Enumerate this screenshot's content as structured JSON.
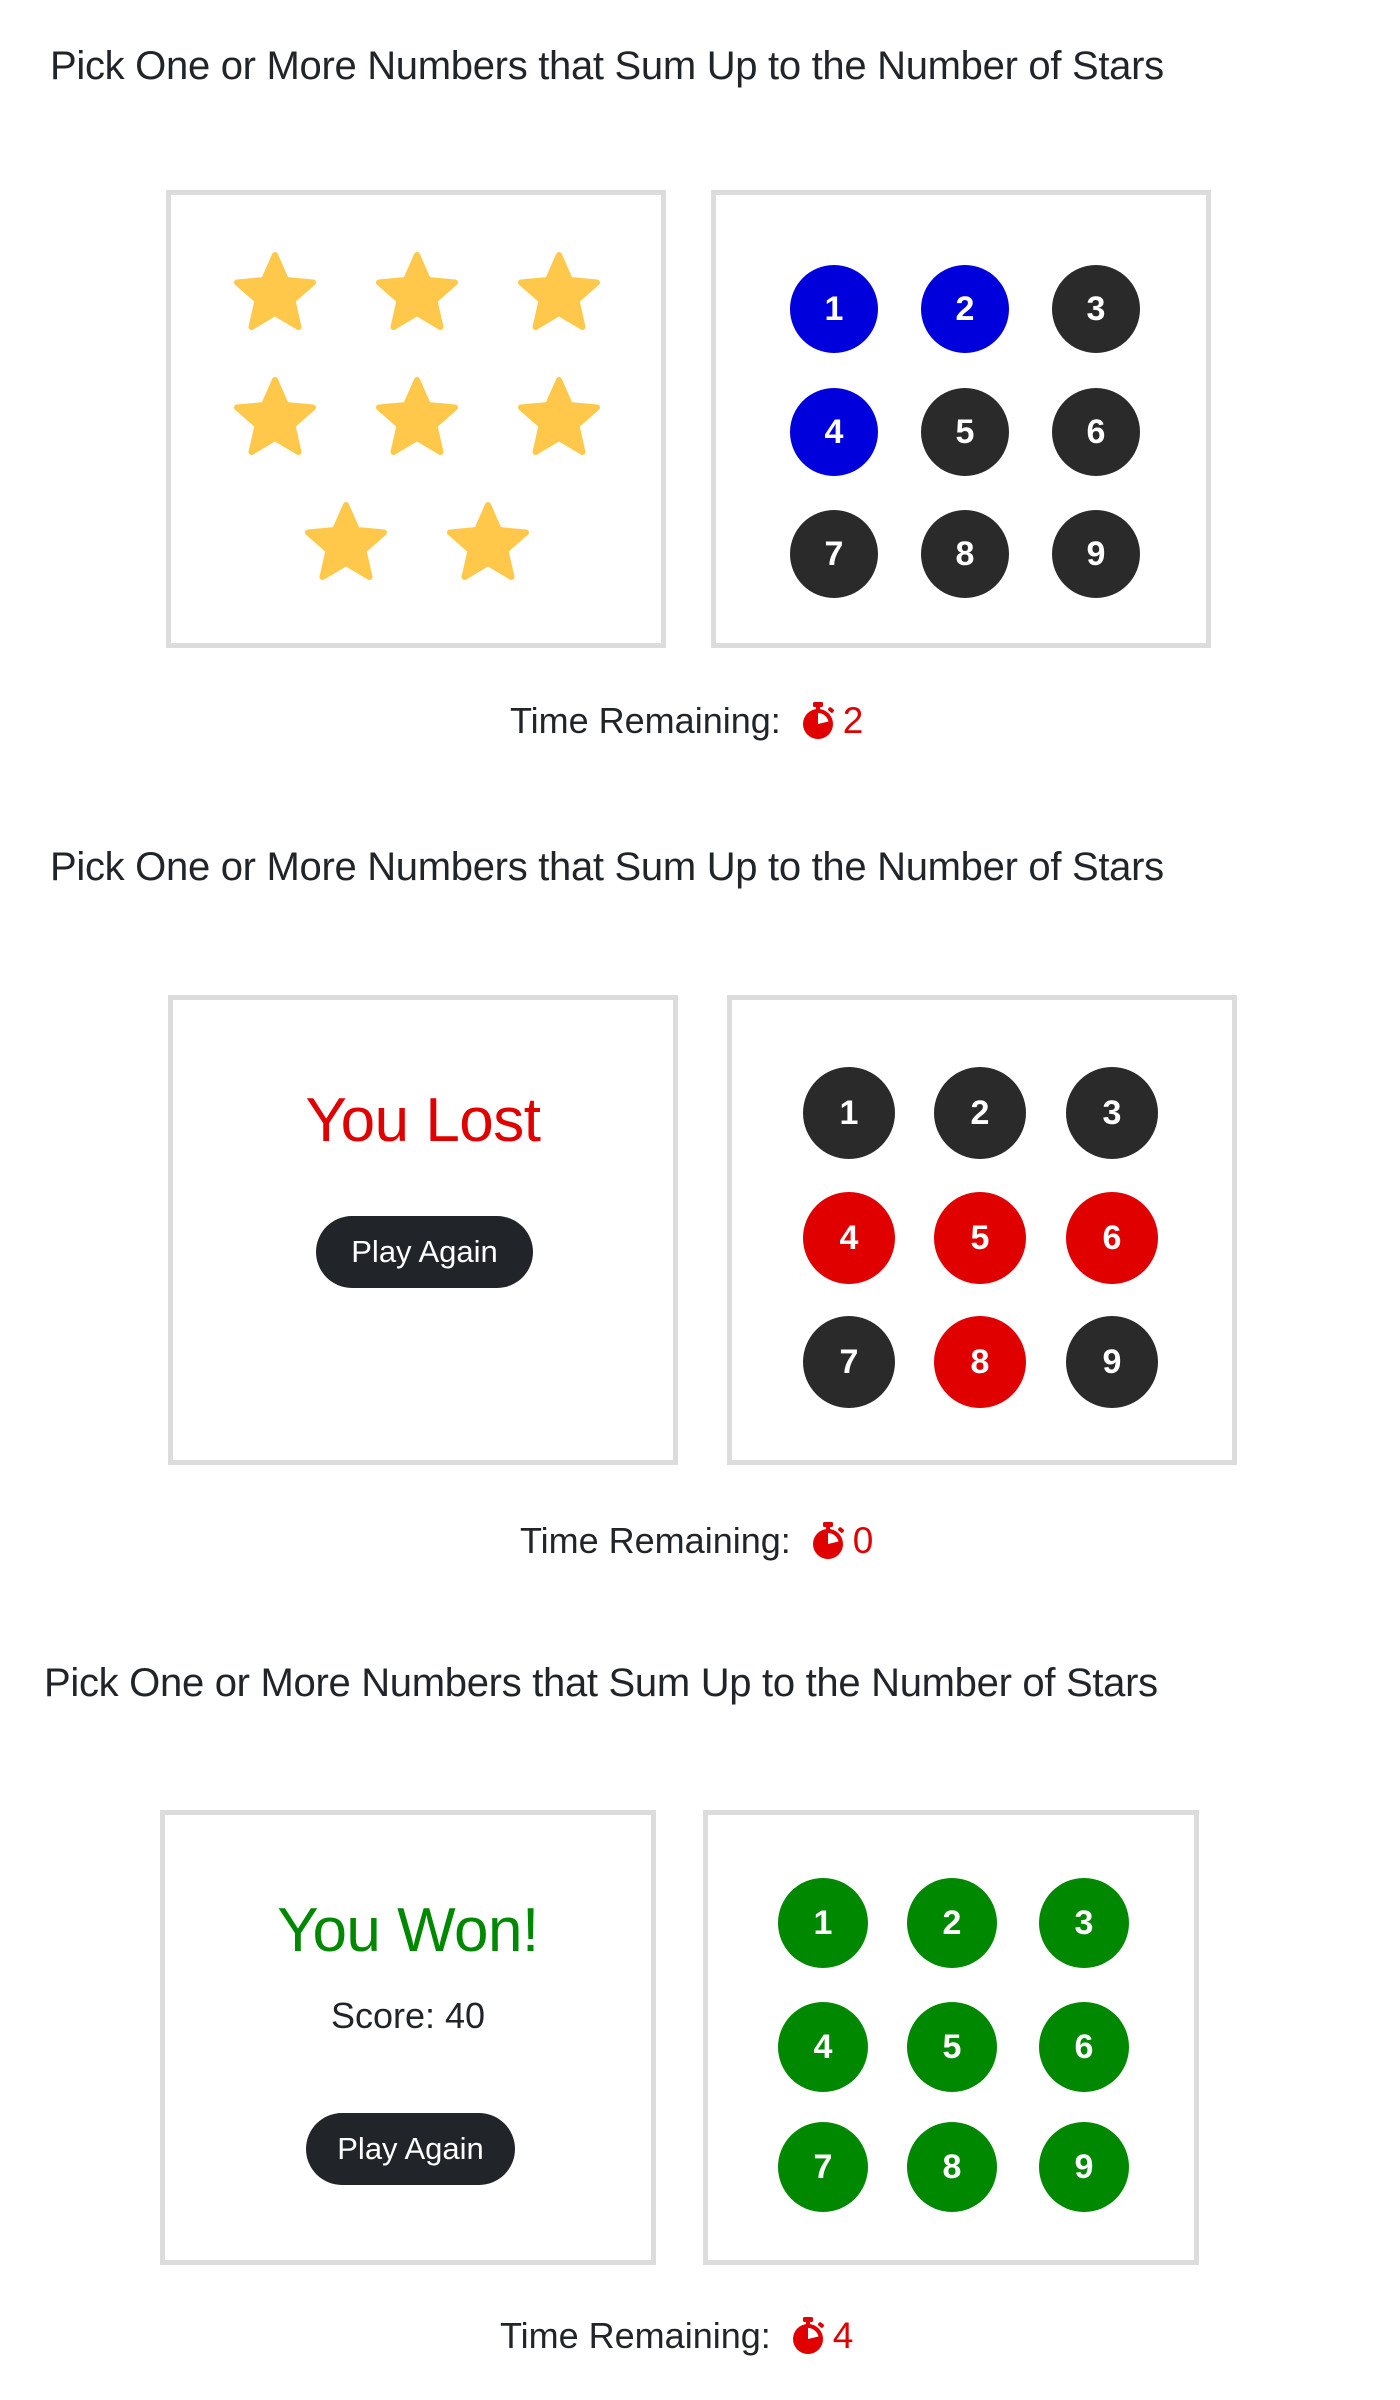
{
  "colors": {
    "star": "#ffc84a",
    "available": "#2a2a2a",
    "candidate": "#0000dd",
    "wrong": "#e00000",
    "used": "#008800",
    "lost": "#e00000",
    "won": "#008800",
    "button": "#212529",
    "timer": "#e00000"
  },
  "icons": {
    "star": "star-icon",
    "timer": "stopwatch-icon"
  },
  "games": [
    {
      "title": "Pick One or More Numbers that Sum Up to the Number of Stars",
      "state": "playing",
      "stars_count": 8,
      "numbers": [
        {
          "label": "1",
          "status": "candidate"
        },
        {
          "label": "2",
          "status": "candidate"
        },
        {
          "label": "3",
          "status": "available"
        },
        {
          "label": "4",
          "status": "candidate"
        },
        {
          "label": "5",
          "status": "available"
        },
        {
          "label": "6",
          "status": "available"
        },
        {
          "label": "7",
          "status": "available"
        },
        {
          "label": "8",
          "status": "available"
        },
        {
          "label": "9",
          "status": "available"
        }
      ],
      "timer": {
        "label": "Time Remaining:",
        "value": "2"
      }
    },
    {
      "title": "Pick One or More Numbers that Sum Up to the Number of Stars",
      "state": "lost",
      "result": {
        "message": "You Lost",
        "button_label": "Play Again"
      },
      "numbers": [
        {
          "label": "1",
          "status": "available"
        },
        {
          "label": "2",
          "status": "available"
        },
        {
          "label": "3",
          "status": "available"
        },
        {
          "label": "4",
          "status": "wrong"
        },
        {
          "label": "5",
          "status": "wrong"
        },
        {
          "label": "6",
          "status": "wrong"
        },
        {
          "label": "7",
          "status": "available"
        },
        {
          "label": "8",
          "status": "wrong"
        },
        {
          "label": "9",
          "status": "available"
        }
      ],
      "timer": {
        "label": "Time Remaining:",
        "value": "0"
      }
    },
    {
      "title": "Pick One or More Numbers that Sum Up to the Number of Stars",
      "state": "won",
      "result": {
        "message": "You Won!",
        "score_label": "Score:",
        "score_value": "40",
        "button_label": "Play Again"
      },
      "numbers": [
        {
          "label": "1",
          "status": "used"
        },
        {
          "label": "2",
          "status": "used"
        },
        {
          "label": "3",
          "status": "used"
        },
        {
          "label": "4",
          "status": "used"
        },
        {
          "label": "5",
          "status": "used"
        },
        {
          "label": "6",
          "status": "used"
        },
        {
          "label": "7",
          "status": "used"
        },
        {
          "label": "8",
          "status": "used"
        },
        {
          "label": "9",
          "status": "used"
        }
      ],
      "timer": {
        "label": "Time Remaining:",
        "value": "4"
      }
    }
  ]
}
